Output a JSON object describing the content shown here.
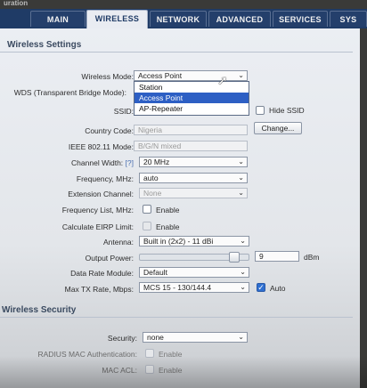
{
  "window": {
    "title": "uration"
  },
  "tabs": [
    {
      "label": "MAIN",
      "active": false
    },
    {
      "label": "WIRELESS",
      "active": true
    },
    {
      "label": "NETWORK",
      "active": false
    },
    {
      "label": "ADVANCED",
      "active": false
    },
    {
      "label": "SERVICES",
      "active": false
    },
    {
      "label": "SYS",
      "active": false
    }
  ],
  "wireless_settings": {
    "title": "Wireless Settings",
    "wireless_mode": {
      "label": "Wireless Mode:",
      "value": "Access Point"
    },
    "wds": {
      "label": "WDS (Transparent Bridge Mode):"
    },
    "ssid": {
      "label": "SSID:",
      "hide_ssid_label": "Hide SSID"
    },
    "country_code": {
      "label": "Country Code:",
      "value": "Nigeria",
      "change_button": "Change..."
    },
    "ieee_mode": {
      "label": "IEEE 802.11 Mode:",
      "value": "B/G/N mixed"
    },
    "channel_width": {
      "label": "Channel Width:",
      "help": "[?]",
      "value": "20 MHz"
    },
    "frequency": {
      "label": "Frequency, MHz:",
      "value": "auto"
    },
    "extension_channel": {
      "label": "Extension Channel:",
      "value": "None"
    },
    "frequency_list": {
      "label": "Frequency List, MHz:",
      "check_label": "Enable"
    },
    "calculate_eirp": {
      "label": "Calculate EIRP Limit:",
      "check_label": "Enable"
    },
    "antenna": {
      "label": "Antenna:",
      "value": "Built in (2x2) - 11 dBi"
    },
    "output_power": {
      "label": "Output Power:",
      "value": "9",
      "unit": "dBm",
      "level": 0.9
    },
    "data_rate_module": {
      "label": "Data Rate Module:",
      "value": "Default"
    },
    "max_tx_rate": {
      "label": "Max TX Rate, Mbps:",
      "value": "MCS 15 - 130/144.4",
      "auto_label": "Auto"
    }
  },
  "mode_dropdown_options": [
    "Station",
    "Access Point",
    "AP-Repeater"
  ],
  "wireless_security": {
    "title": "Wireless Security",
    "security": {
      "label": "Security:",
      "value": "none"
    },
    "radius_mac": {
      "label": "RADIUS MAC Authentication:",
      "check_label": "Enable"
    },
    "mac_acl": {
      "label": "MAC ACL:",
      "check_label": "Enable"
    }
  },
  "colors": {
    "tabbar": "#1f3b66",
    "selection": "#2d5fc4",
    "panel": "#ebeef3"
  }
}
